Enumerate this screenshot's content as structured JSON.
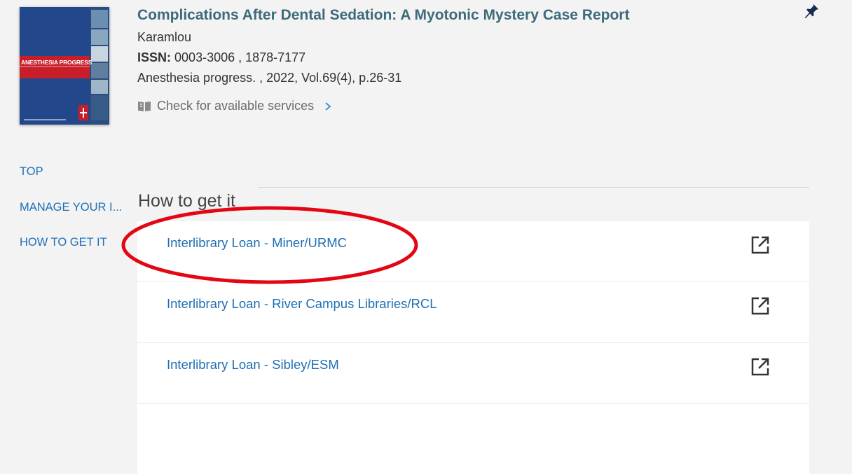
{
  "record": {
    "title": "Complications After Dental Sedation: A Myotonic Mystery Case Report",
    "author": "Karamlou",
    "issn_label": "ISSN:",
    "issn_values": "0003-3006 , 1878-7177",
    "source": "Anesthesia progress. , 2022, Vol.69(4), p.26-31",
    "services_label": "Check for available services",
    "cover_title": "ANESTHESIA PROGRESS"
  },
  "nav": {
    "items": [
      {
        "label": "TOP"
      },
      {
        "label": "MANAGE YOUR I..."
      },
      {
        "label": "HOW TO GET IT"
      }
    ]
  },
  "section": {
    "heading": "How to get it"
  },
  "services": [
    {
      "label": "Interlibrary Loan - Miner/URMC"
    },
    {
      "label": "Interlibrary Loan - River Campus Libraries/RCL"
    },
    {
      "label": "Interlibrary Loan - Sibley/ESM"
    },
    {
      "label": ""
    }
  ],
  "icons": {
    "pin": "pin-icon",
    "book": "book-open-icon",
    "chevron": "chevron-right-icon",
    "external": "external-link-icon"
  },
  "colors": {
    "background": "#f3f3f3",
    "title": "#3d6b7a",
    "link": "#1f6fb4",
    "annotation": "#e30613"
  }
}
